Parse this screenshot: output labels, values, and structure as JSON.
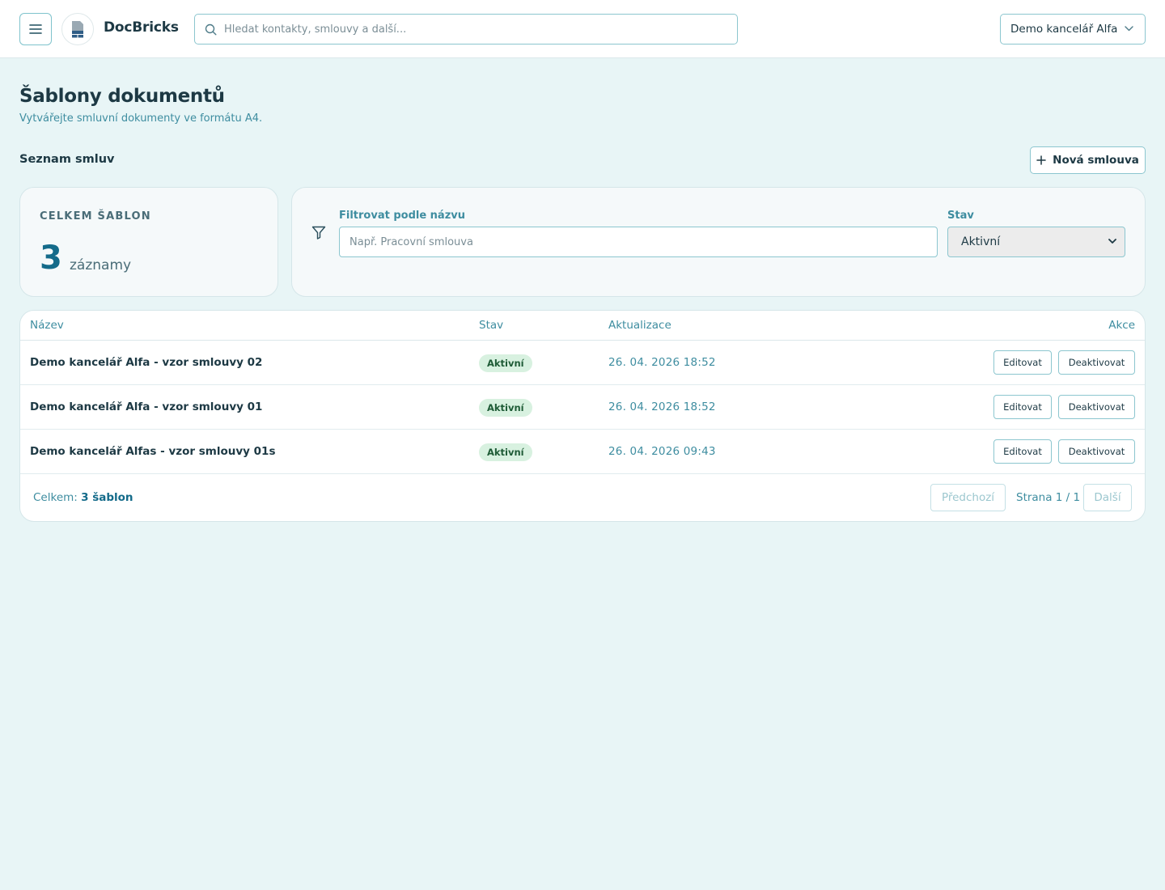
{
  "header": {
    "brand": "DocBricks",
    "search_placeholder": "Hledat kontakty, smlouvy a další...",
    "office": "Demo kancelář Alfa"
  },
  "page": {
    "title": "Šablony dokumentů",
    "subtitle": "Vytvářejte smluvní dokumenty ve formátu A4.",
    "section_title": "Seznam smluv",
    "new_button": "Nová smlouva"
  },
  "stats": {
    "label": "CELKEM ŠABLON",
    "value": "3",
    "unit": "záznamy"
  },
  "filter": {
    "name_label": "Filtrovat podle názvu",
    "name_placeholder": "Např. Pracovní smlouva",
    "status_label": "Stav",
    "status_value": "Aktivní"
  },
  "table": {
    "columns": [
      "Název",
      "Stav",
      "Aktualizace",
      "Akce"
    ],
    "rows": [
      {
        "name": "Demo kancelář Alfa - vzor smlouvy 02",
        "status": "Aktivní",
        "updated": "26. 04. 2026 18:52",
        "edit": "Editovat",
        "deactivate": "Deaktivovat"
      },
      {
        "name": "Demo kancelář Alfa - vzor smlouvy 01",
        "status": "Aktivní",
        "updated": "26. 04. 2026 18:52",
        "edit": "Editovat",
        "deactivate": "Deaktivovat"
      },
      {
        "name": "Demo kancelář Alfas - vzor smlouvy 01s",
        "status": "Aktivní",
        "updated": "26. 04. 2026 09:43",
        "edit": "Editovat",
        "deactivate": "Deaktivovat"
      }
    ]
  },
  "footer": {
    "total_prefix": "Celkem:",
    "total_value": "3 šablon",
    "prev": "Předchozí",
    "page_info": "Strana 1 / 1",
    "next": "Další"
  },
  "colors": {
    "accent": "#146b8a",
    "background": "#e8f5f6",
    "badge_bg": "#d8f1e0",
    "border": "#8cc6cf"
  }
}
